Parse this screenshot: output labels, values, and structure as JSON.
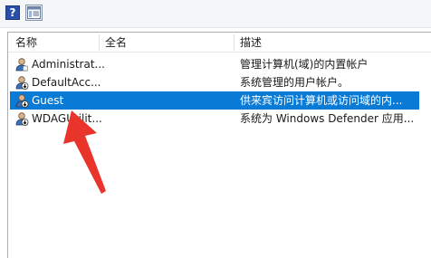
{
  "toolbar": {
    "help_glyph": "?",
    "icons": [
      "help-icon",
      "show-hide-pane-icon"
    ]
  },
  "columns": {
    "name": "名称",
    "fullname": "全名",
    "description": "描述"
  },
  "users": [
    {
      "name": "Administrat...",
      "fullname": "",
      "description": "管理计算机(域)的内置帐户",
      "selected": false,
      "disabled": false
    },
    {
      "name": "DefaultAcc...",
      "fullname": "",
      "description": "系统管理的用户帐户。",
      "selected": false,
      "disabled": true
    },
    {
      "name": "Guest",
      "fullname": "",
      "description": "供来宾访问计算机或访问域的内...",
      "selected": true,
      "disabled": true
    },
    {
      "name": "WDAGUtilit...",
      "fullname": "",
      "description": "系统为 Windows Defender 应用...",
      "selected": false,
      "disabled": true
    }
  ],
  "colors": {
    "selection": "#0a7ad7",
    "annotation_arrow": "#e8342b"
  }
}
